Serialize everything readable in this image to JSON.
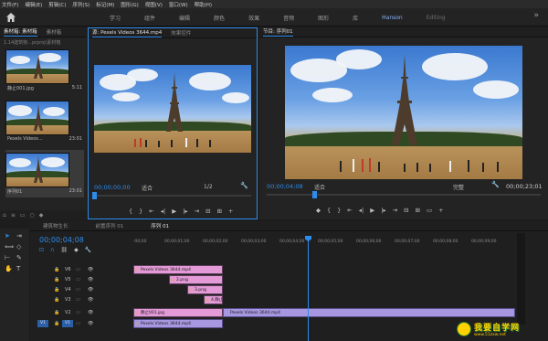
{
  "menu": [
    "文件(F)",
    "编辑(E)",
    "剪辑(C)",
    "序列(S)",
    "标记(M)",
    "图形(G)",
    "视图(V)",
    "窗口(W)",
    "帮助(H)"
  ],
  "workspaces": [
    {
      "label": "学习",
      "state": "normal"
    },
    {
      "label": "组件",
      "state": "normal"
    },
    {
      "label": "编辑",
      "state": "normal"
    },
    {
      "label": "颜色",
      "state": "normal"
    },
    {
      "label": "效果",
      "state": "normal"
    },
    {
      "label": "音频",
      "state": "normal"
    },
    {
      "label": "图形",
      "state": "normal"
    },
    {
      "label": "库",
      "state": "normal"
    },
    {
      "label": "Hanson",
      "state": "active"
    },
    {
      "label": "Editing",
      "state": "dim"
    }
  ],
  "workspace_more": "»",
  "project": {
    "tabs": [
      "素材箱: 素材箱",
      "素材箱"
    ],
    "path": "1.14建筑物...prproj\\素材箱",
    "items": [
      {
        "name": "静止001.jpg",
        "duration": "5:11"
      },
      {
        "name": "Pexels Videos...",
        "duration": "23:01"
      },
      {
        "name": "序列01",
        "duration": "23:01"
      }
    ],
    "tools": [
      "⌂",
      "≡",
      "▭",
      "○",
      "◆"
    ]
  },
  "source": {
    "tabs": [
      "源: Pexels Videos 3644.mp4",
      "效果控件"
    ],
    "timecode": "00;00;00;00",
    "fit": "适合",
    "resolution": "1/2",
    "controls": [
      "{",
      "}",
      "⇤",
      "◂|",
      "▶",
      "|▸",
      "⇥",
      "⊟",
      "⊞",
      "+"
    ]
  },
  "program": {
    "tabs": [
      "节目: 序列01"
    ],
    "timecode": "00;00;04;08",
    "fit": "适合",
    "quality": "完整",
    "end_timecode": "00;00;23;01",
    "controls": [
      "◆",
      "{",
      "}",
      "⇤",
      "◂|",
      "▶",
      "|▸",
      "⇥",
      "⊟",
      "⊞",
      "▭",
      "+"
    ]
  },
  "timeline": {
    "tabs": [
      "建筑物生长",
      "前置序列 01",
      "序列 01"
    ],
    "timecode": "00;00;04;08",
    "ruler": [
      ":00;00",
      "00;00;01;00",
      "00;00;02;00",
      "00;00;03;00",
      "00;00;04;00",
      "00;00;05;00",
      "00;00;06;00",
      "00;00;07;00",
      "00;00;08;00",
      "00;00;09;00"
    ],
    "tracks": [
      {
        "name": "V6"
      },
      {
        "name": "V5"
      },
      {
        "name": "V4"
      },
      {
        "name": "V3"
      },
      {
        "name": "V2"
      },
      {
        "name": "V1"
      }
    ],
    "source_patch": "V1",
    "clips": [
      {
        "label": "Pexels Videos 3644.mp4",
        "track": "V6"
      },
      {
        "label": "2.png",
        "track": "V5"
      },
      {
        "label": "3.png",
        "track": "V4"
      },
      {
        "label": "4.静止",
        "track": "V3"
      },
      {
        "label": "静止001.jpg",
        "track": "V2"
      },
      {
        "label": "Pexels Videos 3644.mp4",
        "track": "V2b"
      },
      {
        "label": "Pexels Videos 3644.mp4",
        "track": "V1"
      }
    ]
  },
  "watermark": {
    "title": "我要自学网",
    "url": "www.51zxw.net"
  },
  "colors": {
    "accent": "#2d8ceb",
    "clip_pink": "#e39ad6",
    "clip_violet": "#a697e0"
  }
}
